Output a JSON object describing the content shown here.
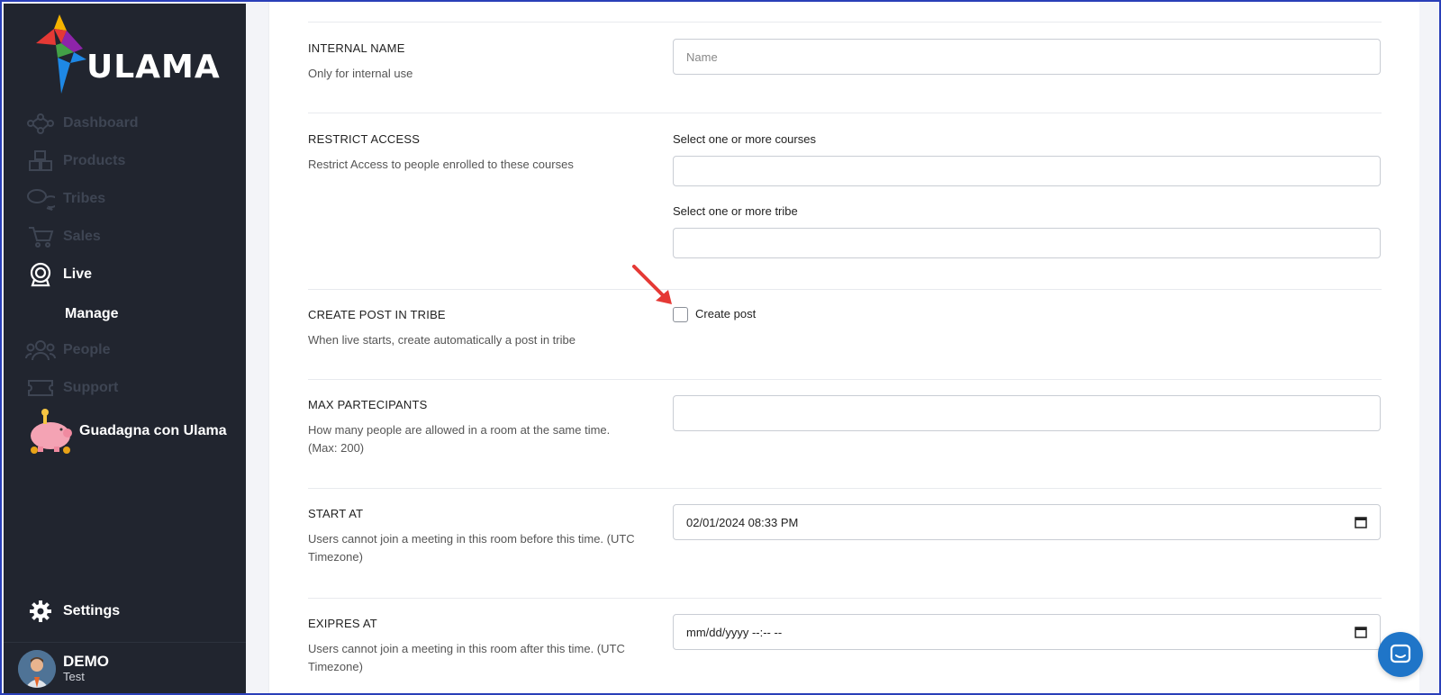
{
  "app": {
    "logo_text": "ULAMA"
  },
  "sidebar": {
    "items": [
      {
        "label": "Dashboard",
        "icon": "network-icon"
      },
      {
        "label": "Products",
        "icon": "cubes-icon"
      },
      {
        "label": "Tribes",
        "icon": "chat-bubbles-icon"
      },
      {
        "label": "Sales",
        "icon": "cart-icon"
      },
      {
        "label": "Live",
        "icon": "webcam-icon"
      },
      {
        "label": "People",
        "icon": "people-icon"
      },
      {
        "label": "Support",
        "icon": "ticket-icon"
      }
    ],
    "sub_item": "Manage",
    "earn_label": "Guadagna con Ulama",
    "settings_label": "Settings",
    "user": {
      "name": "DEMO",
      "subtitle": "Test"
    }
  },
  "form": {
    "internal_name": {
      "title": "INTERNAL NAME",
      "desc": "Only for internal use",
      "placeholder": "Name"
    },
    "restrict_access": {
      "title": "RESTRICT ACCESS",
      "desc": "Restrict Access to people enrolled to these courses",
      "courses_label": "Select one or more courses",
      "tribe_label": "Select one or more tribe"
    },
    "create_post": {
      "title": "CREATE POST IN TRIBE",
      "desc": "When live starts, create automatically a post in tribe",
      "checkbox_label": "Create post",
      "checked": false
    },
    "max_participants": {
      "title": "MAX PARTECIPANTS",
      "desc": "How many people are allowed in a room at the same time. (Max: 200)"
    },
    "start_at": {
      "title": "START AT",
      "desc": "Users cannot join a meeting in this room before this time. (UTC Timezone)",
      "value": "02/01/2024 08:33 PM"
    },
    "expires_at": {
      "title": "EXIPRES AT",
      "desc": "Users cannot join a meeting in this room after this time. (UTC Timezone)",
      "placeholder": "mm/dd/yyyy --:-- --"
    }
  },
  "colors": {
    "sidebar_bg": "#21252f",
    "accent_arrow": "#e53935",
    "chat_button": "#1f75c8"
  }
}
